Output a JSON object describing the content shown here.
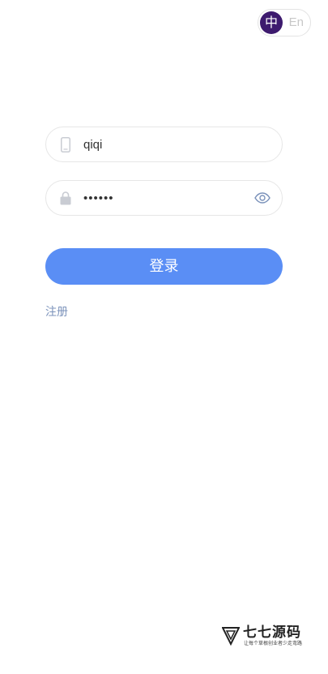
{
  "language_toggle": {
    "zh_label": "中",
    "en_label": "En",
    "active": "zh",
    "active_color": "#3d1a6e"
  },
  "login_form": {
    "username": {
      "value": "qiqi",
      "icon": "phone-icon"
    },
    "password": {
      "value": "••••••",
      "icon": "lock-icon",
      "toggle_icon": "eye-icon"
    },
    "submit_label": "登录",
    "submit_color": "#5a8ef5",
    "register_label": "注册"
  },
  "watermark": {
    "title": "七七源码",
    "subtitle": "让每个草根创业者少走弯路"
  }
}
